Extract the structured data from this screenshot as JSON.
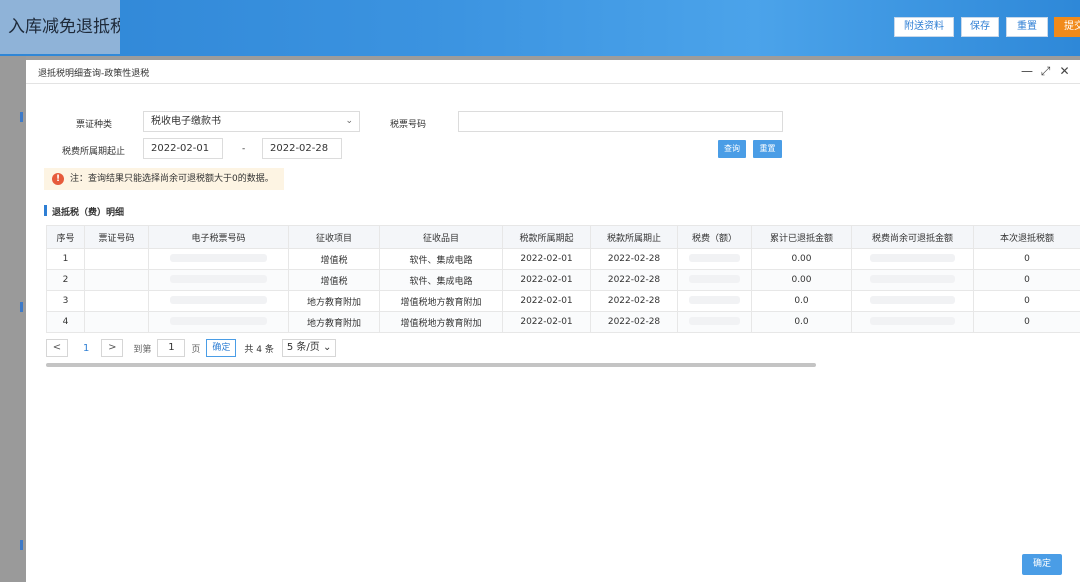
{
  "background": {
    "page_title": "入库减免退抵税",
    "buttons": [
      {
        "label": "附送资料"
      },
      {
        "label": "保存"
      },
      {
        "label": "重置"
      },
      {
        "label": "提交"
      }
    ]
  },
  "modal": {
    "title": "退抵税明细查询-政策性退税",
    "controls": {
      "minimize": "—",
      "maximize": "⤢",
      "close": "✕"
    }
  },
  "form": {
    "voucher_type_label": "票证种类",
    "voucher_type_value": "税收电子缴款书",
    "tax_ticket_label": "税票号码",
    "tax_ticket_value": "",
    "period_label": "税费所属期起止",
    "period_start": "2022-02-01",
    "period_sep": "-",
    "period_end": "2022-02-28",
    "query_button": "查询",
    "reset_button": "重置"
  },
  "notice": {
    "icon": "!",
    "text": "注：查询结果只能选择尚余可退税额大于0的数据。"
  },
  "section": {
    "title": "退抵税（费）明细"
  },
  "table": {
    "headers": [
      "序号",
      "票证号码",
      "电子税票号码",
      "征收项目",
      "征收品目",
      "税款所属期起",
      "税款所属期止",
      "税费（额）",
      "累计已退抵金额",
      "税费尚余可退抵金额",
      "本次退抵税额"
    ],
    "rows": [
      {
        "index": "1",
        "item": "增值税",
        "sub_item": "软件、集成电路",
        "start": "2022-02-01",
        "end": "2022-02-28",
        "refunded": "0.00",
        "current": "0"
      },
      {
        "index": "2",
        "item": "增值税",
        "sub_item": "软件、集成电路",
        "start": "2022-02-01",
        "end": "2022-02-28",
        "refunded": "0.00",
        "current": "0"
      },
      {
        "index": "3",
        "item": "地方教育附加",
        "sub_item": "增值税地方教育附加",
        "start": "2022-02-01",
        "end": "2022-02-28",
        "refunded": "0.0",
        "current": "0"
      },
      {
        "index": "4",
        "item": "地方教育附加",
        "sub_item": "增值税地方教育附加",
        "start": "2022-02-01",
        "end": "2022-02-28",
        "refunded": "0.0",
        "current": "0"
      }
    ]
  },
  "pager": {
    "prev": "<",
    "current_page": "1",
    "next": ">",
    "goto_label": "到第",
    "goto_value": "1",
    "page_unit": "页",
    "confirm": "确定",
    "total": "共 4 条",
    "page_size": "5 条/页"
  },
  "footer": {
    "confirm_button": "确定"
  }
}
